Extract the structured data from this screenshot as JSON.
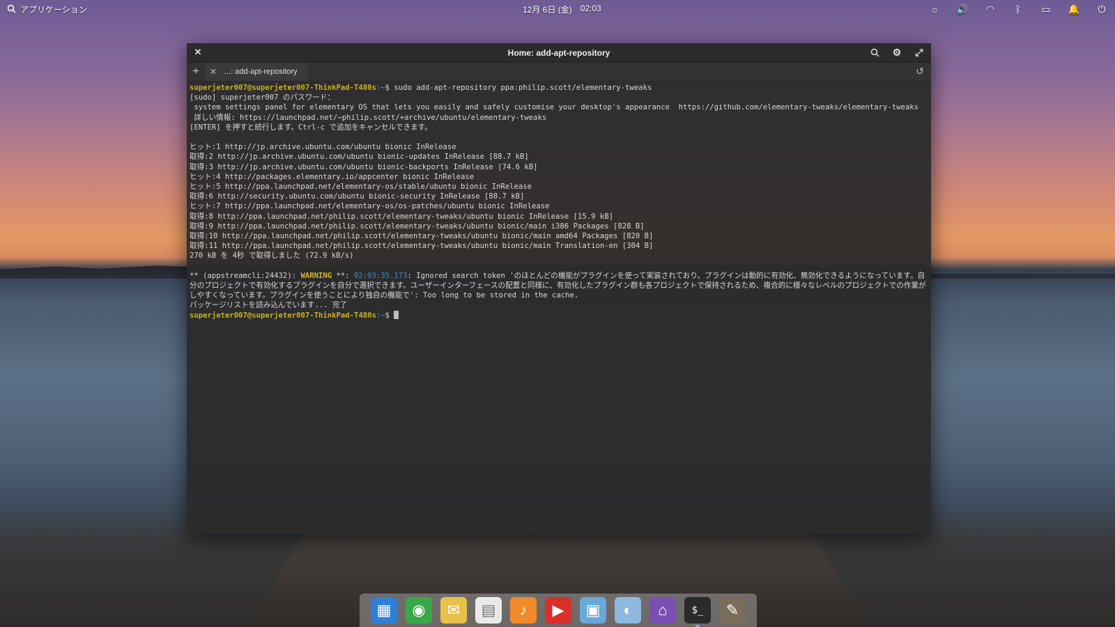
{
  "panel": {
    "apps_label": "アプリケーション",
    "date": "12月 6日 (金)",
    "time": "02:03"
  },
  "indicators": [
    {
      "icon": "brightness-icon",
      "glyph": "☼"
    },
    {
      "icon": "volume-icon",
      "glyph": "🔊"
    },
    {
      "icon": "wifi-icon",
      "glyph": "◠"
    },
    {
      "icon": "bluetooth-icon",
      "glyph": "ᛒ"
    },
    {
      "icon": "battery-icon",
      "glyph": "▭"
    },
    {
      "icon": "notifications-icon",
      "glyph": "🔔"
    },
    {
      "icon": "power-icon",
      "glyph": "⏻"
    }
  ],
  "window": {
    "title": "Home: add-apt-repository",
    "tab_label": "...: add-apt-repository"
  },
  "terminal": {
    "prompt": "superjeter007@superjeter007-ThinkPad-T480s",
    "path": ":~",
    "command": "$ sudo add-apt-repository ppa:philip.scott/elementary-tweaks",
    "lines_a": [
      "[sudo] superjeter007 のパスワード：",
      " system settings panel for elementary OS that lets you easily and safely customise your desktop's appearance  https://github.com/elementary-tweaks/elementary-tweaks",
      " 詳しい情報: https://launchpad.net/~philip.scott/+archive/ubuntu/elementary-tweaks",
      "[ENTER] を押すと続行します。Ctrl-c で追加をキャンセルできます。",
      "",
      "ヒット:1 http://jp.archive.ubuntu.com/ubuntu bionic InRelease",
      "取得:2 http://jp.archive.ubuntu.com/ubuntu bionic-updates InRelease [88.7 kB]",
      "取得:3 http://jp.archive.ubuntu.com/ubuntu bionic-backports InRelease [74.6 kB]",
      "ヒット:4 http://packages.elementary.io/appcenter bionic InRelease",
      "ヒット:5 http://ppa.launchpad.net/elementary-os/stable/ubuntu bionic InRelease",
      "取得:6 http://security.ubuntu.com/ubuntu bionic-security InRelease [88.7 kB]",
      "ヒット:7 http://ppa.launchpad.net/elementary-os/os-patches/ubuntu bionic InRelease",
      "取得:8 http://ppa.launchpad.net/philip.scott/elementary-tweaks/ubuntu bionic InRelease [15.9 kB]",
      "取得:9 http://ppa.launchpad.net/philip.scott/elementary-tweaks/ubuntu bionic/main i386 Packages [828 B]",
      "取得:10 http://ppa.launchpad.net/philip.scott/elementary-tweaks/ubuntu bionic/main amd64 Packages [820 B]",
      "取得:11 http://ppa.launchpad.net/philip.scott/elementary-tweaks/ubuntu bionic/main Translation-en [304 B]",
      "270 kB を 4秒 で取得しました (72.9 kB/s)",
      ""
    ],
    "warn_prefix": "** (appstreamcli:24432): ",
    "warn_word": "WARNING",
    "warn_mid": " **: ",
    "warn_time": "02:03:35.173",
    "warn_msg": ": Ignored search token 'のほとんどの機能がプラグインを使って実装されており、プラグインは動的に有効化、無効化できるようになっています。自分のプロジェクトで有効化するプラグインを自分で選択できます。ユーザーインターフェースの配置と同様に、有効化したプラグイン群も各プロジェクトで保持されるため、複合的に様々なレベルのプロジェクトでの作業がしやすくなっています。プラグインを使うことにより独自の機能で': Too long to be stored in the cache.",
    "done_line": "パッケージリストを読み込んでいます... 完了",
    "final_prompt_suffix": "$ "
  },
  "dock": [
    {
      "name": "multitasking-view-icon",
      "glyph": "▦",
      "bg": "#2f7fd6"
    },
    {
      "name": "web-browser-icon",
      "glyph": "◉",
      "bg": "#3aa84a"
    },
    {
      "name": "mail-icon",
      "glyph": "✉",
      "bg": "#e8c04a"
    },
    {
      "name": "calendar-icon",
      "glyph": "▤",
      "bg": "#e9e9e9"
    },
    {
      "name": "music-icon",
      "glyph": "♪",
      "bg": "#f08a2b"
    },
    {
      "name": "videos-icon",
      "glyph": "▶",
      "bg": "#d9302c"
    },
    {
      "name": "photos-icon",
      "glyph": "▣",
      "bg": "#6aa8d8"
    },
    {
      "name": "system-settings-icon",
      "glyph": "◐",
      "bg": "#8fb8de"
    },
    {
      "name": "appcenter-icon",
      "glyph": "⌂",
      "bg": "#7a4fb4"
    },
    {
      "name": "terminal-icon",
      "glyph": "$_",
      "bg": "#2a2a2a"
    },
    {
      "name": "gimp-icon",
      "glyph": "✎",
      "bg": "#7a6e5a"
    }
  ]
}
